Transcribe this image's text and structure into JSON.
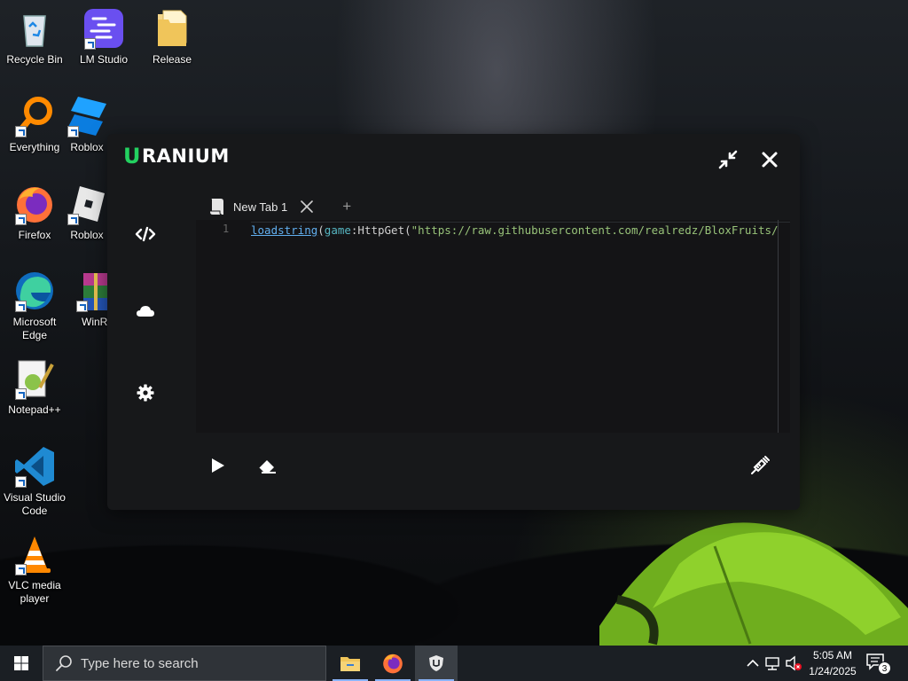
{
  "desktop": {
    "icons": [
      {
        "label": "Recycle Bin"
      },
      {
        "label": "LM Studio"
      },
      {
        "label": "Release"
      },
      {
        "label": "Everything"
      },
      {
        "label": "Roblox"
      },
      {
        "label": "Firefox"
      },
      {
        "label": "Roblox"
      },
      {
        "label": "Microsoft Edge"
      },
      {
        "label": "WinR"
      },
      {
        "label": "Notepad++"
      },
      {
        "label": "Visual Studio Code"
      },
      {
        "label": "VLC media player"
      }
    ]
  },
  "app": {
    "brand_initial": "U",
    "brand_rest": "RANIUM",
    "accent": "#23d160",
    "tabs": [
      {
        "label": "New Tab 1"
      }
    ],
    "add_tab_symbol": "+",
    "editor": {
      "line_number": "1",
      "code_fn": "loadstring",
      "code_p1": "(",
      "code_kw": "game",
      "code_p2": ":HttpGet(",
      "code_str": "\"https://raw.githubusercontent.com/realredz/BloxFruits/"
    },
    "sidebar_icons": [
      "code-icon",
      "cloud-icon",
      "gear-icon"
    ],
    "bottom_icons": [
      "play-icon",
      "eraser-icon",
      "inject-icon"
    ]
  },
  "taskbar": {
    "search_placeholder": "Type here to search",
    "time": "5:05 AM",
    "date": "1/24/2025",
    "notification_count": "3"
  }
}
